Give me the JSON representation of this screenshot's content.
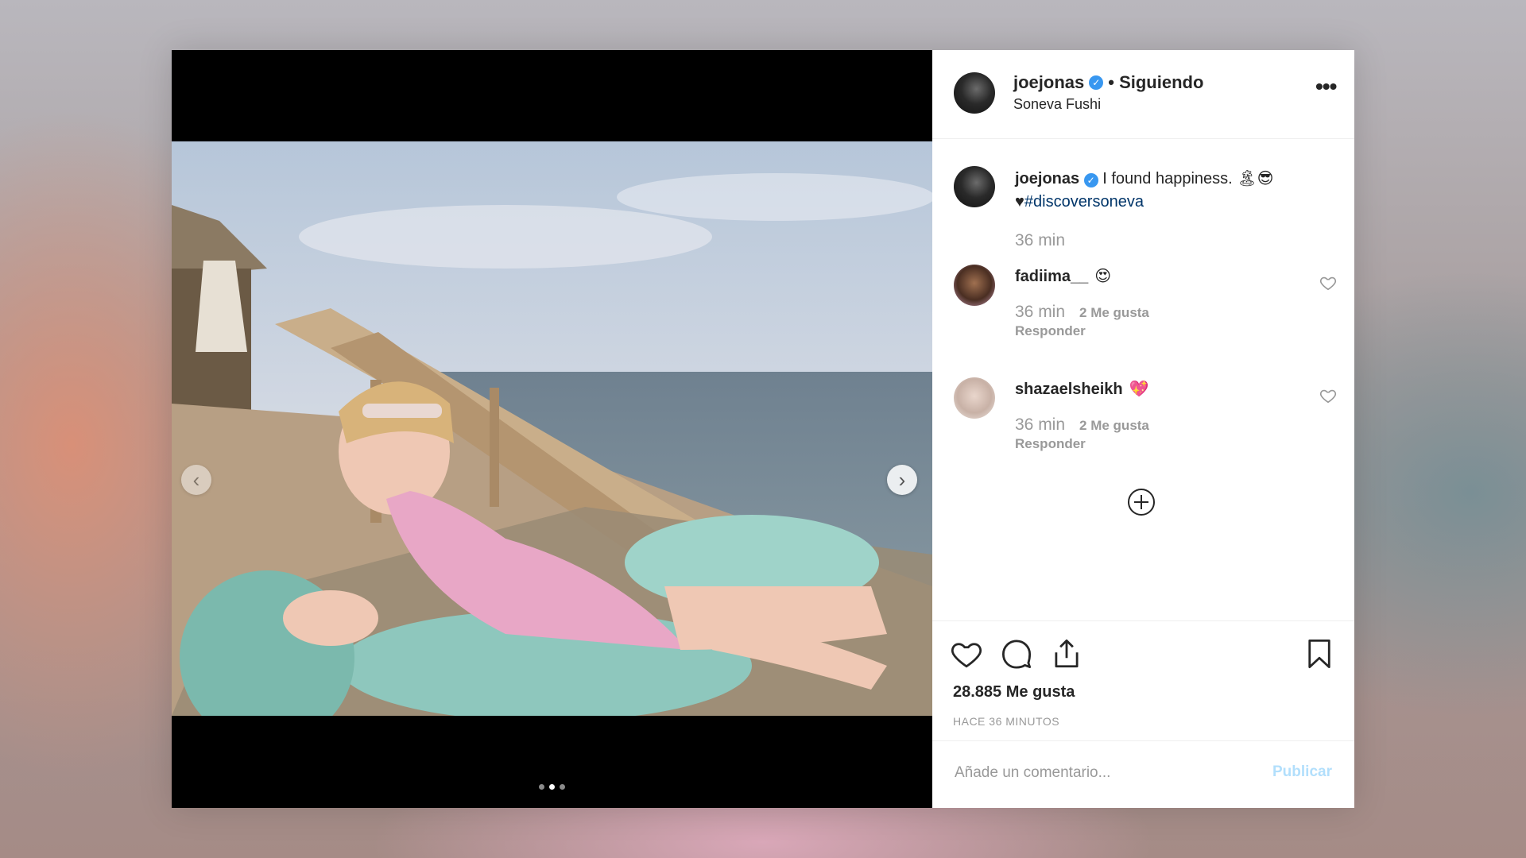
{
  "post": {
    "username": "joejonas",
    "follow_status": "• Siguiendo",
    "location": "Soneva Fushi",
    "more_label": "•••",
    "caption": {
      "username": "joejonas",
      "text": "I found happiness. 🏝😎",
      "line2_prefix": "♥",
      "hashtag": "#discoversoneva",
      "time": "36 min"
    },
    "comments": [
      {
        "username": "fadiima__",
        "emoji": "😍",
        "time": "36 min",
        "likes": "2 Me gusta",
        "reply": "Responder"
      },
      {
        "username": "shazaelsheikh",
        "emoji": "💖",
        "time": "36 min",
        "likes": "2 Me gusta",
        "reply": "Responder"
      }
    ],
    "likes_count": "28.885 Me gusta",
    "posted_ago": "HACE 36 MINUTOS",
    "comment_placeholder": "Añade un comentario...",
    "publish_label": "Publicar"
  },
  "carousel": {
    "prev": "‹",
    "next": "›",
    "total_slides": 3,
    "current_slide": 2
  },
  "colors": {
    "verified": "#3897f0",
    "hashtag": "#003569",
    "publish_disabled": "#b2dffc",
    "muted": "#999999"
  }
}
